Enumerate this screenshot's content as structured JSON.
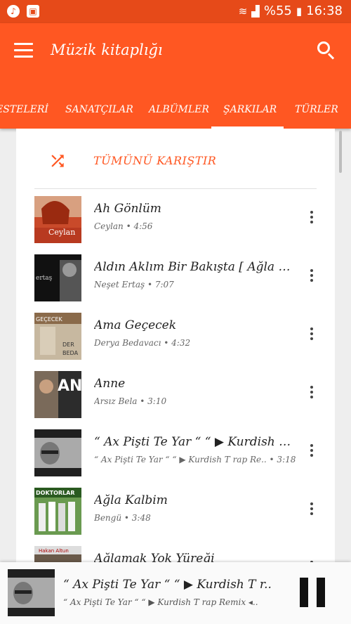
{
  "status_bar": {
    "left_icons": [
      "music-note-icon",
      "image-icon"
    ],
    "battery": "%55",
    "time": "16:38"
  },
  "app_bar": {
    "title": "Müzik kitaplığı",
    "tabs": [
      {
        "label": "ESTELERİ"
      },
      {
        "label": "SANATÇILAR"
      },
      {
        "label": "ALBÜMLER"
      },
      {
        "label": "ŞARKILAR",
        "selected": true
      },
      {
        "label": "TÜRLER"
      }
    ]
  },
  "shuffle": {
    "label": "TÜMÜNÜ KARIŞTIR"
  },
  "songs": [
    {
      "title": "Ah Gönlüm",
      "subtitle": "Ceylan • 4:56",
      "art_text": "Ceylan"
    },
    {
      "title": "Aldın Aklım Bir Bakışta [ Ağla Sazı..",
      "subtitle": "Neşet Ertaş • 7:07",
      "art_text": "ertaş"
    },
    {
      "title": "Ama Geçecek",
      "subtitle": "Derya Bedavacı • 4:32",
      "art_text": "GEÇECEK",
      "art_text2": "DER",
      "art_text3": "BEDA"
    },
    {
      "title": "Anne",
      "subtitle": "Arsız Bela • 3:10",
      "art_text": "AN"
    },
    {
      "title": "“ Ax Pişti Te Yar “  “ ▶ Kurdish T r..",
      "subtitle": "“ Ax Pişti Te Yar “  “ ▶ Kurdish T rap Re..  • 3:18",
      "art_text": ""
    },
    {
      "title": "Ağla Kalbim",
      "subtitle": "Bengü • 3:48",
      "art_text": "DOKTORLAR"
    },
    {
      "title": "Ağlamak Yok Yüreği",
      "subtitle": "",
      "art_text": "Hakan Altun"
    }
  ],
  "now_playing": {
    "title": "“ Ax Pişti Te Yar “  “ ▶ Kurdish T r..",
    "subtitle": "“ Ax Pişti Te Yar “  “ ▶ Kurdish T rap Remix ◂.."
  },
  "colors": {
    "accent": "#ff5722",
    "status_bar": "#e64a19"
  }
}
